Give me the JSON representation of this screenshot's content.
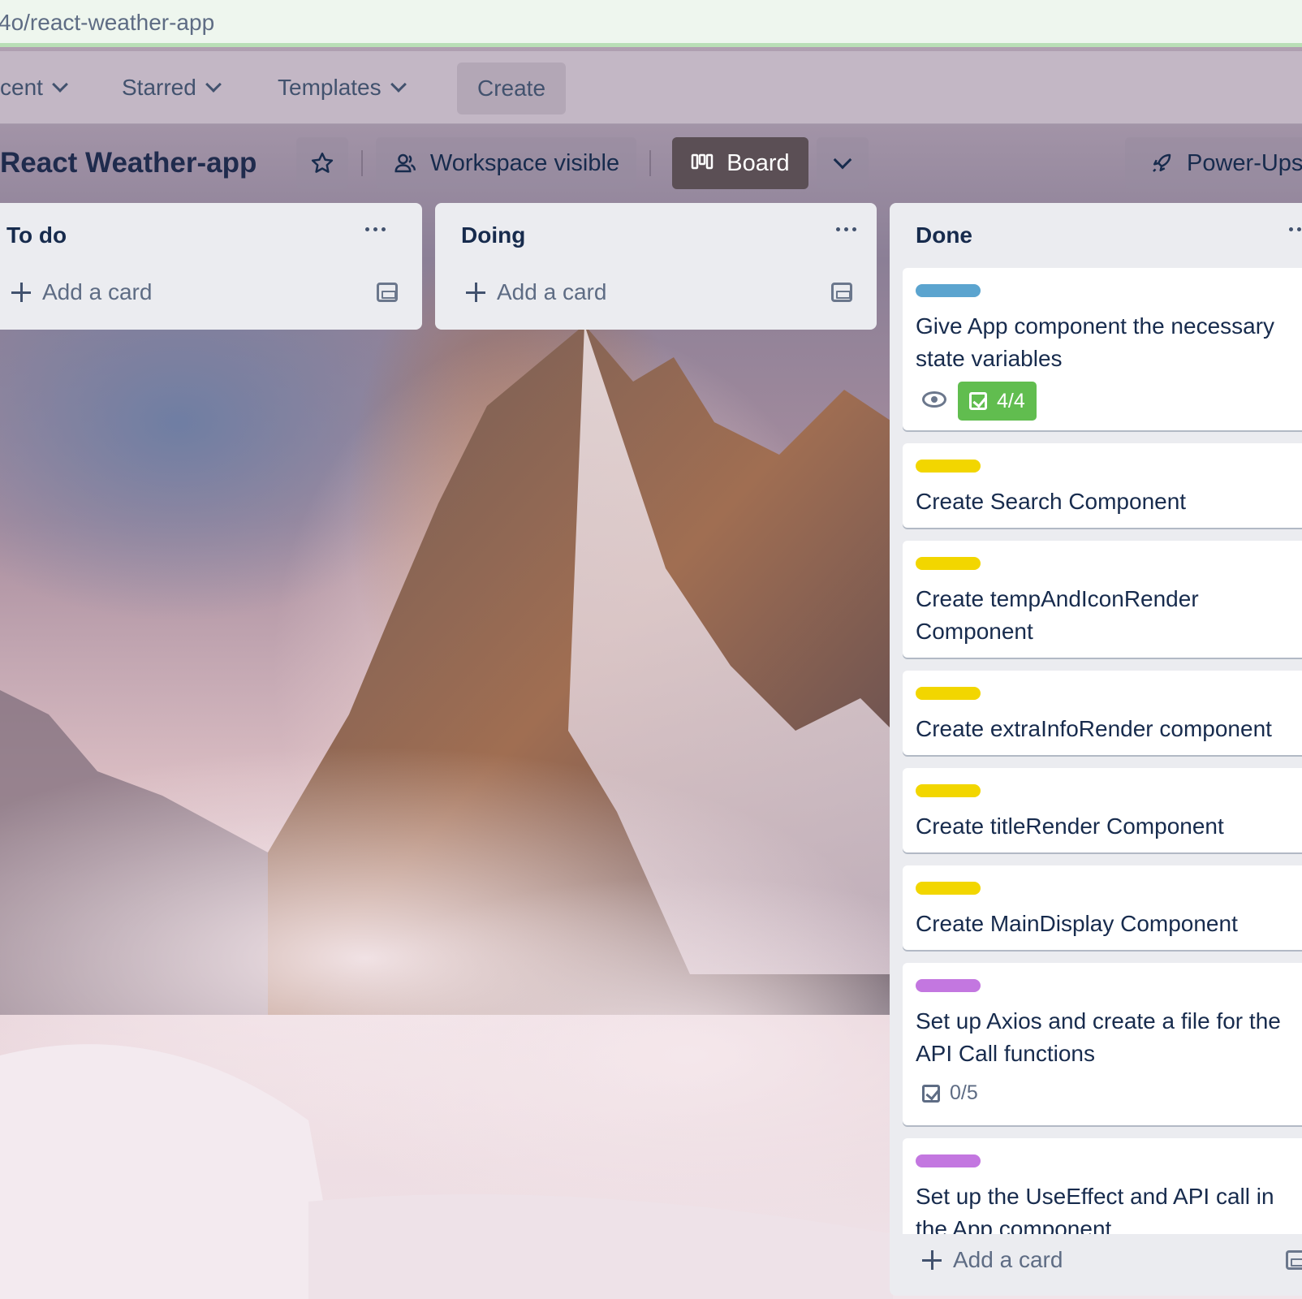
{
  "browser": {
    "url": "4o/react-weather-app"
  },
  "topnav": {
    "items": [
      {
        "label": "cent"
      },
      {
        "label": "Starred"
      },
      {
        "label": "Templates"
      }
    ],
    "create_label": "Create"
  },
  "board": {
    "title": "React Weather-app",
    "visibility_label": "Workspace visible",
    "view_label": "Board",
    "powerups_label": "Power-Ups"
  },
  "lists": [
    {
      "title": "To do",
      "add_card_label": "Add a card"
    },
    {
      "title": "Doing",
      "add_card_label": "Add a card"
    },
    {
      "title": "Done",
      "add_card_label": "Add a card",
      "cards": [
        {
          "label_color": "#5ba4cf",
          "title": "Give App component the necessary state variables",
          "checklist": "4/4",
          "checklist_complete": true,
          "watching": true
        },
        {
          "label_color": "#f2d600",
          "title": "Create Search Component"
        },
        {
          "label_color": "#f2d600",
          "title": "Create tempAndIconRender Component"
        },
        {
          "label_color": "#f2d600",
          "title": "Create extraInfoRender component"
        },
        {
          "label_color": "#f2d600",
          "title": "Create titleRender Component"
        },
        {
          "label_color": "#f2d600",
          "title": "Create MainDisplay Component"
        },
        {
          "label_color": "#c377e0",
          "title": "Set up Axios and create a file for the API Call functions",
          "checklist": "0/5",
          "checklist_complete": false
        },
        {
          "label_color": "#c377e0",
          "title": "Set up the UseEffect and API call in the App component"
        }
      ]
    }
  ]
}
